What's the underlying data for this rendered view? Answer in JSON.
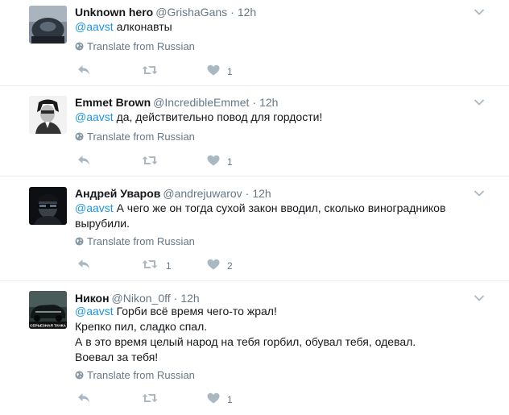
{
  "translate_label": "Translate from Russian",
  "colors": {
    "link": "#1b95e0",
    "muted": "#657786",
    "icon": "#aab8c2",
    "divider": "#e6ecf0"
  },
  "tweets": [
    {
      "name": "Unknown hero",
      "handle": "@GrishaGans",
      "separator": "·",
      "time": "12h",
      "mention": "@aavst",
      "lines": [
        " алконавты"
      ],
      "retweets": "",
      "likes": "1"
    },
    {
      "name": "Emmet Brown",
      "handle": "@IncredibleEmmet",
      "separator": "·",
      "time": "12h",
      "mention": "@aavst",
      "lines": [
        " да, действительно повод для гордости!"
      ],
      "retweets": "",
      "likes": "1"
    },
    {
      "name": "Андрей Уваров",
      "handle": "@andrejuwarov",
      "separator": "·",
      "time": "12h",
      "mention": "@aavst",
      "lines": [
        " А чего же он тогда сухой закон вводил, сколько виноградников",
        "вырубили."
      ],
      "retweets": "1",
      "likes": "2"
    },
    {
      "name": "Никон",
      "handle": "@Nikon_0ff",
      "separator": "·",
      "time": "12h",
      "mention": "@aavst",
      "lines": [
        " Горби всё время чего-то жрал!",
        "Крепко пил, сладко спал.",
        "А в это время целый народ на тебя горбил, обувал тебя, одевал.",
        "Воевал за тебя!"
      ],
      "retweets": "",
      "likes": "1",
      "avatar_caption": "СЕРЬЕЗНАЯ ТАЧКА"
    }
  ]
}
